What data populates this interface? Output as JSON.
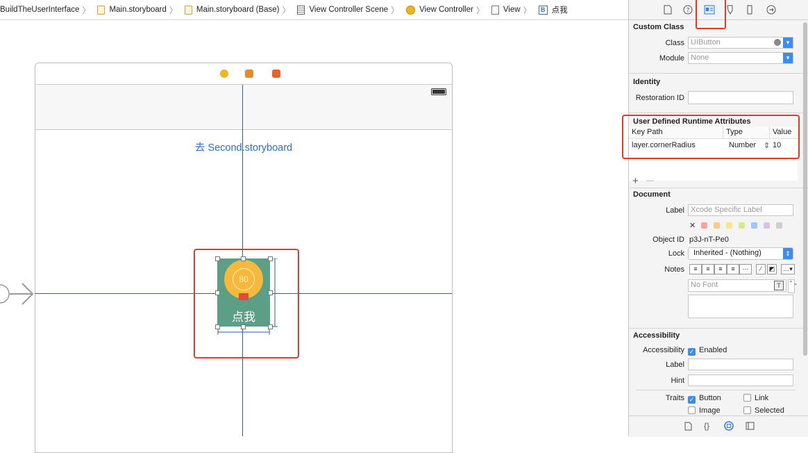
{
  "breadcrumb": [
    {
      "label": "BuildTheUserInterface",
      "icon": "folder-icon"
    },
    {
      "label": "Main.storyboard",
      "icon": "storyboard-file-icon"
    },
    {
      "label": "Main.storyboard (Base)",
      "icon": "storyboard-file-icon"
    },
    {
      "label": "View Controller Scene",
      "icon": "scene-icon"
    },
    {
      "label": "View Controller",
      "icon": "view-controller-icon"
    },
    {
      "label": "View",
      "icon": "view-icon"
    },
    {
      "label": "点我",
      "icon": "button-icon"
    }
  ],
  "canvas": {
    "link_button_title": "去 Second.storyboard",
    "button_title": "点我",
    "button_badge": "80"
  },
  "inspector": {
    "custom_class": {
      "title": "Custom Class",
      "class_label": "Class",
      "class_placeholder": "UIButton",
      "module_label": "Module",
      "module_placeholder": "None"
    },
    "identity": {
      "title": "Identity",
      "restoration_label": "Restoration ID",
      "restoration_value": ""
    },
    "runtime_attributes": {
      "title": "User Defined Runtime Attributes",
      "columns": [
        "Key Path",
        "Type",
        "Value"
      ],
      "rows": [
        {
          "key_path": "layer.cornerRadius",
          "type": "Number",
          "value": "10"
        }
      ],
      "add": "+",
      "remove": "—"
    },
    "document": {
      "title": "Document",
      "label_label": "Label",
      "label_placeholder": "Xcode Specific Label",
      "clear_symbol": "✕",
      "object_id_label": "Object ID",
      "object_id": "p3J-nT-Pe0",
      "lock_label": "Lock",
      "lock_value": "Inherited - (Nothing)",
      "notes_label": "Notes",
      "font_placeholder": "No Font"
    },
    "accessibility": {
      "title": "Accessibility",
      "accessibility_label": "Accessibility",
      "enabled_label": "Enabled",
      "label_label": "Label",
      "hint_label": "Hint",
      "traits_label": "Traits",
      "traits": [
        {
          "label": "Button",
          "checked": true
        },
        {
          "label": "Link",
          "checked": false
        },
        {
          "label": "Image",
          "checked": false
        },
        {
          "label": "Selected",
          "checked": false
        }
      ]
    }
  },
  "colors": {
    "accent": "#3b8cf2",
    "highlight": "#e23a25",
    "button_bg": "#5a9f86",
    "button_circle": "#f6b93b",
    "link_text": "#2a6fd0"
  }
}
